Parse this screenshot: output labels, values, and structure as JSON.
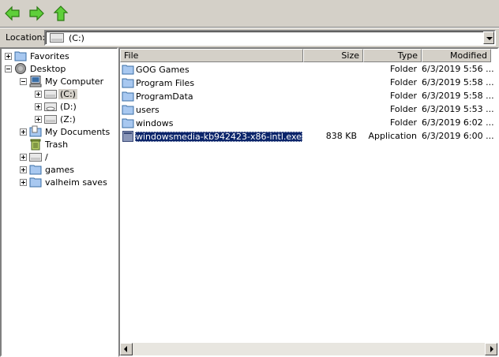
{
  "location": {
    "label": "Location:",
    "value": "(C:)"
  },
  "tree": {
    "items": [
      {
        "label": "Favorites"
      },
      {
        "label": "Desktop"
      },
      {
        "label": "My Computer"
      },
      {
        "label": "(C:)"
      },
      {
        "label": "(D:)"
      },
      {
        "label": "(Z:)"
      },
      {
        "label": "My Documents"
      },
      {
        "label": "Trash"
      },
      {
        "label": "/"
      },
      {
        "label": "games"
      },
      {
        "label": "valheim saves"
      }
    ]
  },
  "list": {
    "columns": [
      "File",
      "Size",
      "Type",
      "Modified"
    ],
    "rows": [
      {
        "name": "GOG Games",
        "size": "",
        "type": "Folder",
        "modified": "6/3/2019 5:56 ..."
      },
      {
        "name": "Program Files",
        "size": "",
        "type": "Folder",
        "modified": "6/3/2019 5:58 ..."
      },
      {
        "name": "ProgramData",
        "size": "",
        "type": "Folder",
        "modified": "6/3/2019 5:58 ..."
      },
      {
        "name": "users",
        "size": "",
        "type": "Folder",
        "modified": "6/3/2019 5:53 ..."
      },
      {
        "name": "windows",
        "size": "",
        "type": "Folder",
        "modified": "6/3/2019 6:02 ..."
      },
      {
        "name": "windowsmedia-kb942423-x86-intl.exe",
        "size": "838 KB",
        "type": "Application",
        "modified": "6/3/2019 6:00 ..."
      }
    ]
  },
  "colors": {
    "selection": "#0a246a",
    "face": "#d4d0c8",
    "arrow_green": "#2fa52f"
  }
}
